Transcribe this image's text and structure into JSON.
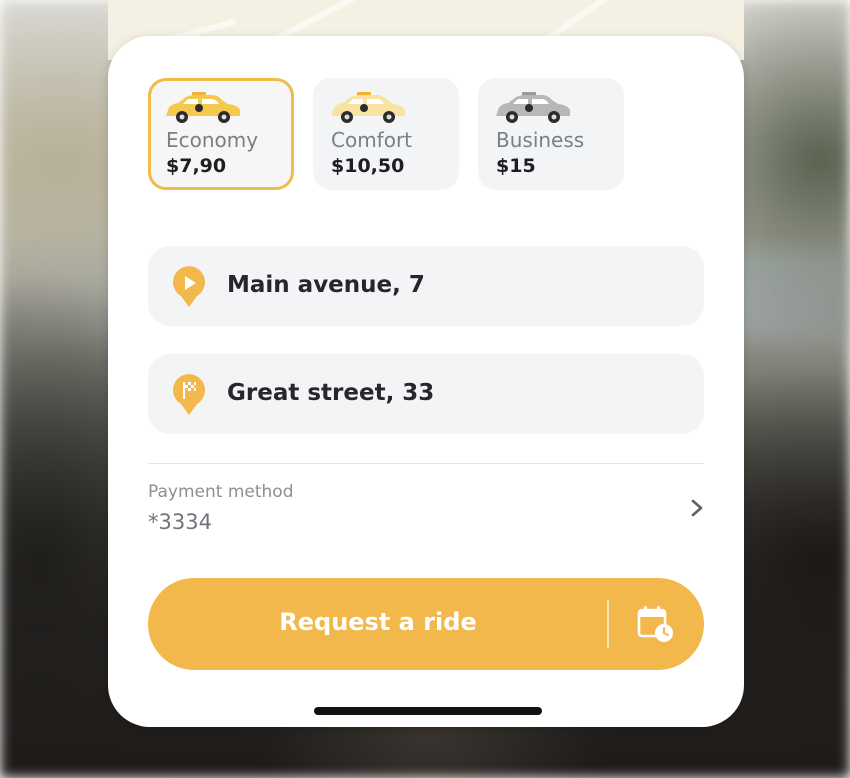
{
  "ride_options": [
    {
      "name": "Economy",
      "price": "$7,90",
      "selected": true,
      "car_color": "#f5c84f"
    },
    {
      "name": "Comfort",
      "price": "$10,50",
      "selected": false,
      "car_color": "#f8e3a2"
    },
    {
      "name": "Business",
      "price": "$15",
      "selected": false,
      "car_color": "#b7b7b9"
    }
  ],
  "route": {
    "pickup": {
      "address": "Main avenue, 7",
      "icon": "play-pin-icon"
    },
    "destination": {
      "address": "Great street, 33",
      "icon": "flag-pin-icon"
    }
  },
  "payment": {
    "label": "Payment method",
    "value": "*3334"
  },
  "actions": {
    "request_label": "Request a ride",
    "schedule_icon": "calendar-clock-icon"
  },
  "colors": {
    "accent": "#f2b84b",
    "selected_border": "#f0bb4a",
    "panel_bg": "#f3f4f6",
    "text_dark": "#26272b",
    "text_muted": "#8b9096"
  }
}
